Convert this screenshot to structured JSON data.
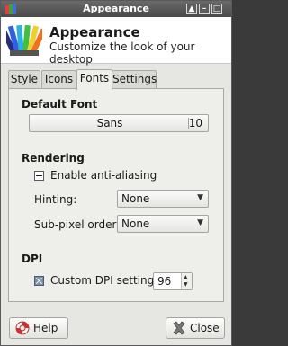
{
  "window": {
    "title": "Appearance",
    "controls": [
      "up-icon",
      "minimize-icon",
      "maximize-icon",
      "close-icon"
    ]
  },
  "header": {
    "title": "Appearance",
    "subtitle": "Customize the look of your desktop"
  },
  "tabs": [
    {
      "label": "Style",
      "active": false
    },
    {
      "label": "Icons",
      "active": false
    },
    {
      "label": "Fonts",
      "active": true
    },
    {
      "label": "Settings",
      "active": false
    }
  ],
  "default_font": {
    "section_title": "Default Font",
    "font_name": "Sans",
    "font_size": "10"
  },
  "rendering": {
    "section_title": "Rendering",
    "antialias_label": "Enable anti-aliasing",
    "antialias_state": "inconsistent",
    "hinting_label": "Hinting:",
    "hinting_value": "None",
    "subpixel_label": "Sub-pixel order:",
    "subpixel_value": "None"
  },
  "dpi": {
    "section_title": "DPI",
    "custom_label": "Custom DPI setting:",
    "custom_checked": true,
    "value": "96"
  },
  "buttons": {
    "help": "Help",
    "close": "Close"
  }
}
